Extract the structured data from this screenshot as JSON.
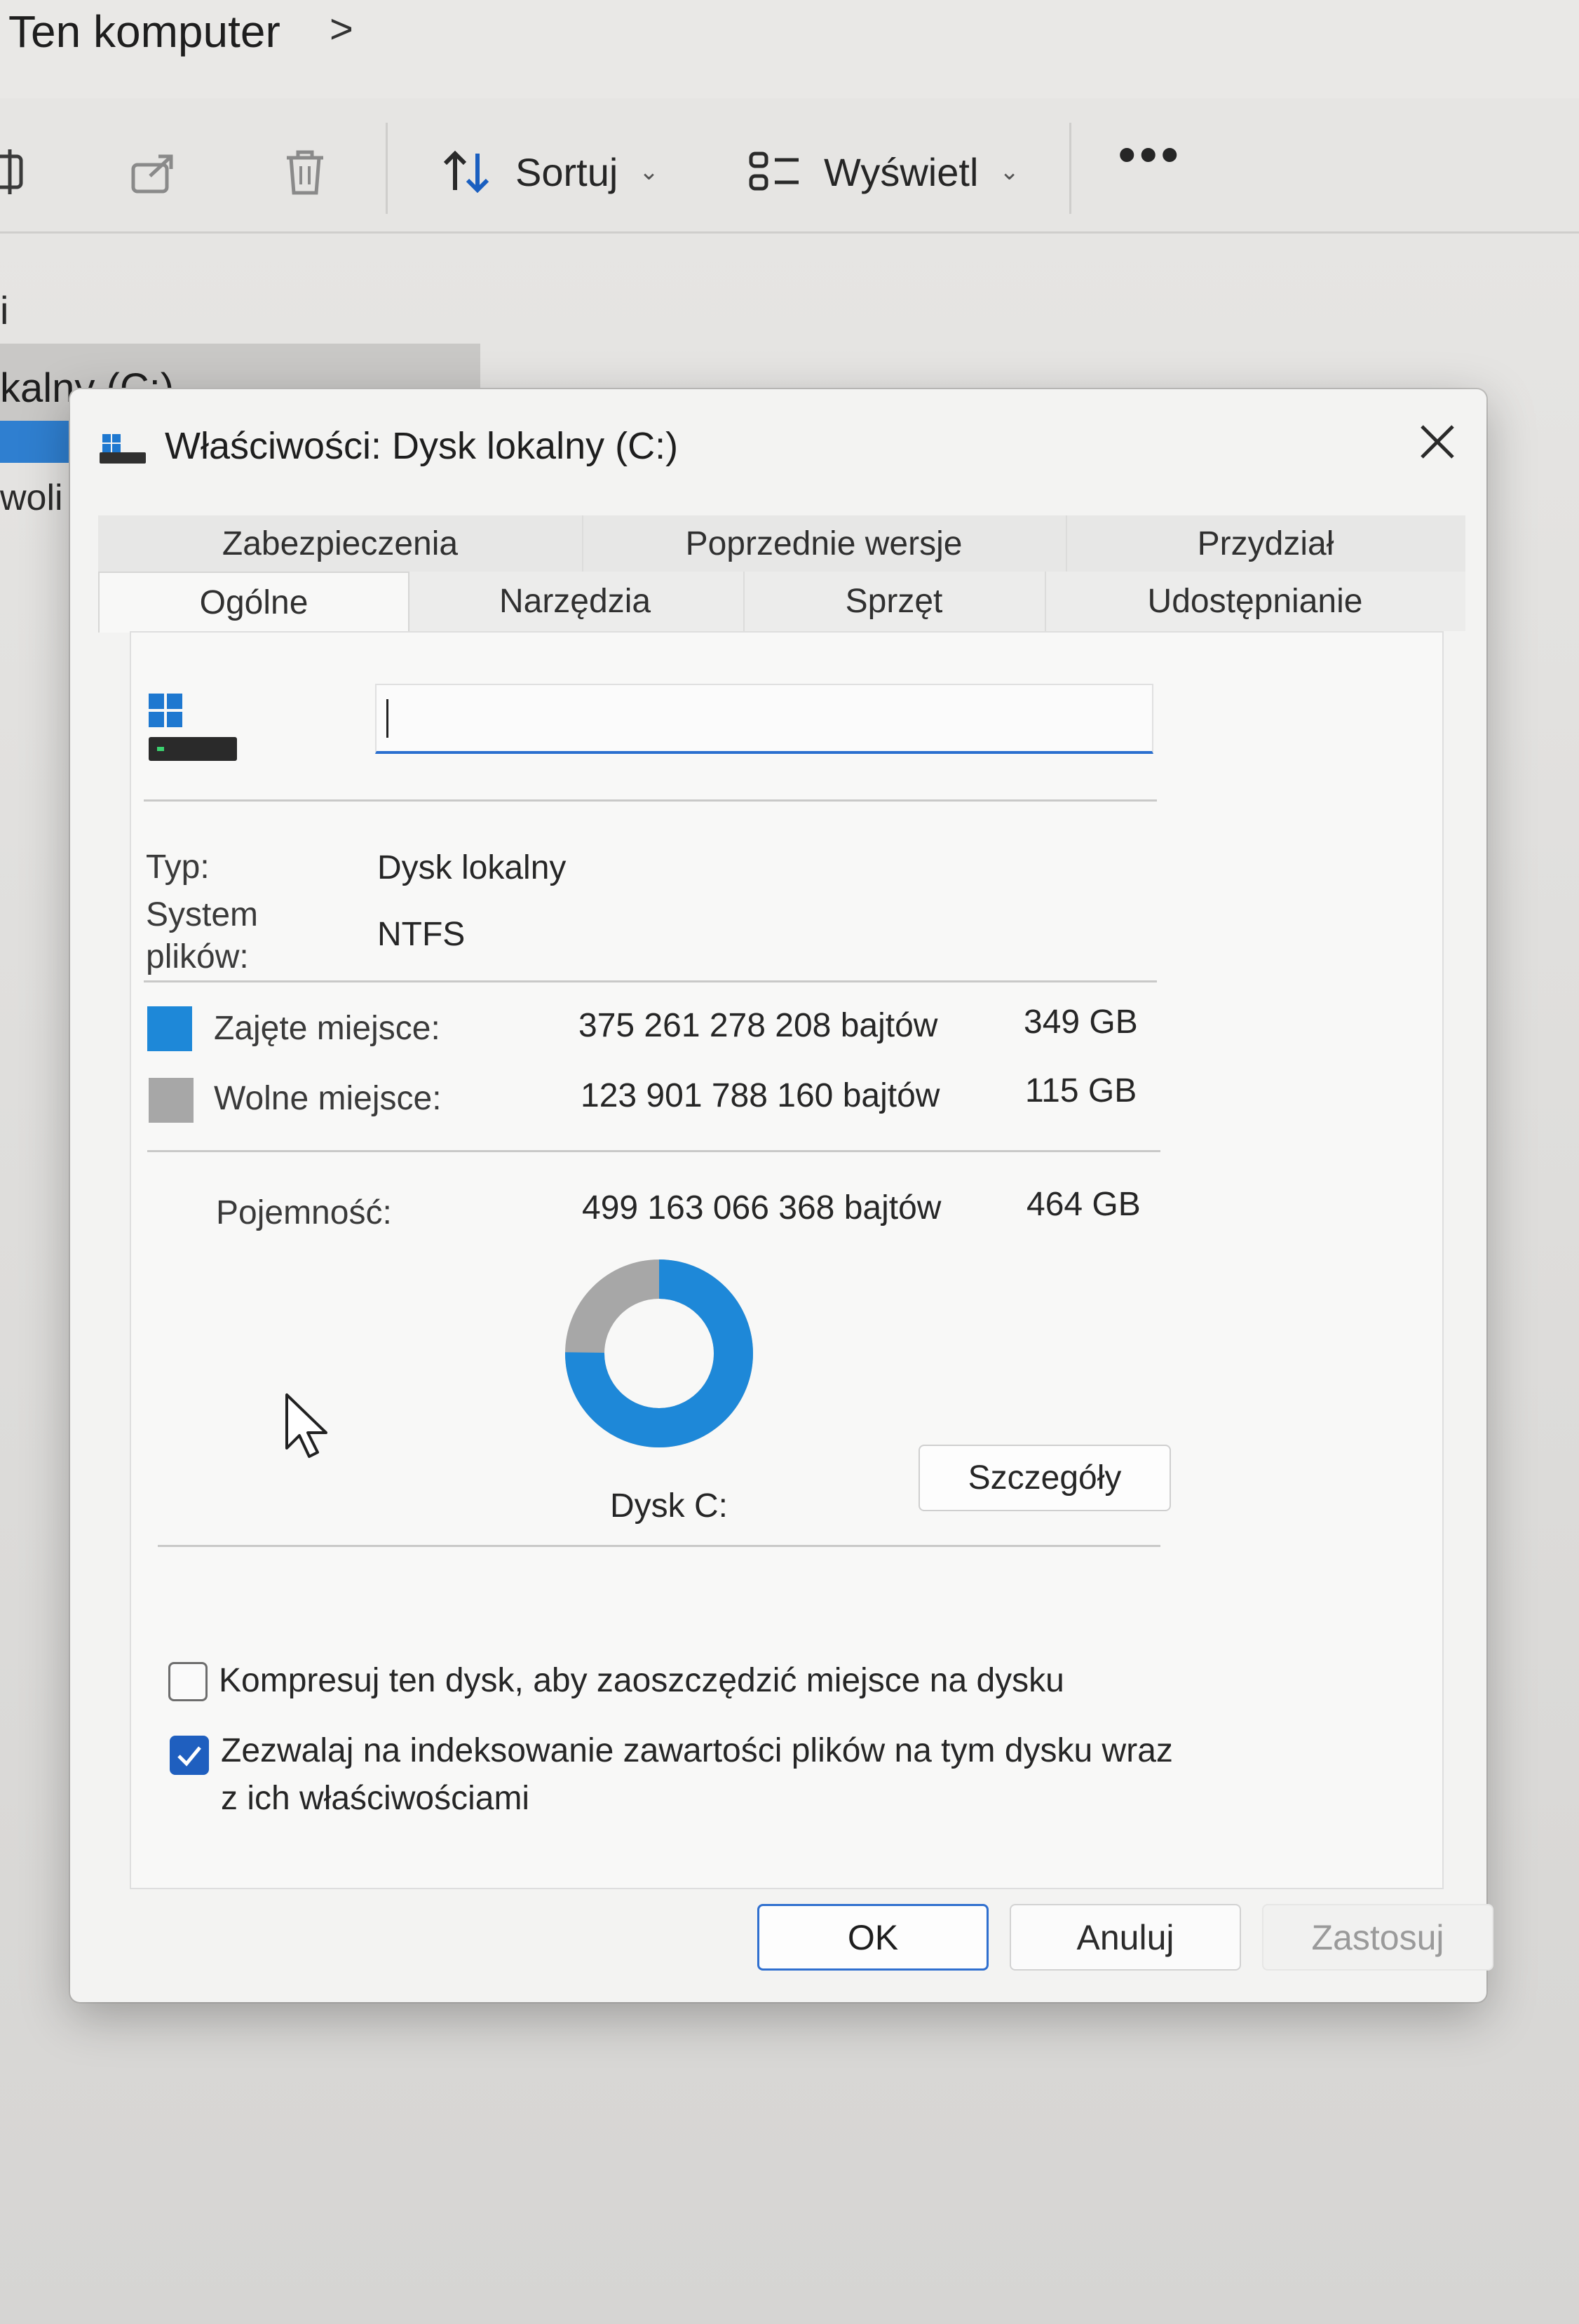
{
  "explorer": {
    "address_title": "Ten komputer",
    "address_chevron": ">",
    "toolbar": {
      "sort_label": "Sortuj",
      "view_label": "Wyświetl",
      "more_label": "•••"
    },
    "nav": {
      "fragment_top": "i",
      "selected_item": "kalny (C:)",
      "fragment_bottom": "woli"
    }
  },
  "dialog": {
    "title": "Właściwości: Dysk lokalny (C:)",
    "tabs_row1": [
      "Zabezpieczenia",
      "Poprzednie wersje",
      "Przydział"
    ],
    "tabs_row2": [
      "Ogólne",
      "Narzędzia",
      "Sprzęt",
      "Udostępnianie"
    ],
    "active_tab": "Ogólne",
    "name_input_value": "",
    "type_label": "Typ:",
    "type_value": "Dysk lokalny",
    "fs_label_line1": "System",
    "fs_label_line2": "plików:",
    "fs_value": "NTFS",
    "used": {
      "label": "Zajęte miejsce:",
      "bytes": "375 261 278 208 bajtów",
      "size": "349 GB",
      "color": "#1e88d8"
    },
    "free": {
      "label": "Wolne miejsce:",
      "bytes": "123 901 788 160 bajtów",
      "size": "115 GB",
      "color": "#a7a7a7"
    },
    "capacity": {
      "label": "Pojemność:",
      "bytes": "499 163 066 368 bajtów",
      "size": "464 GB"
    },
    "used_fraction": 0.7518,
    "drive_caption": "Dysk C:",
    "details_button": "Szczegóły",
    "compress_label": "Kompresuj ten dysk, aby zaoszczędzić miejsce na dysku",
    "compress_checked": false,
    "index_label_line1": "Zezwalaj na indeksowanie zawartości plików na tym dysku wraz",
    "index_label_line2": "z ich właściwościami",
    "index_checked": true,
    "ok_button": "OK",
    "cancel_button": "Anuluj",
    "apply_button": "Zastosuj"
  }
}
